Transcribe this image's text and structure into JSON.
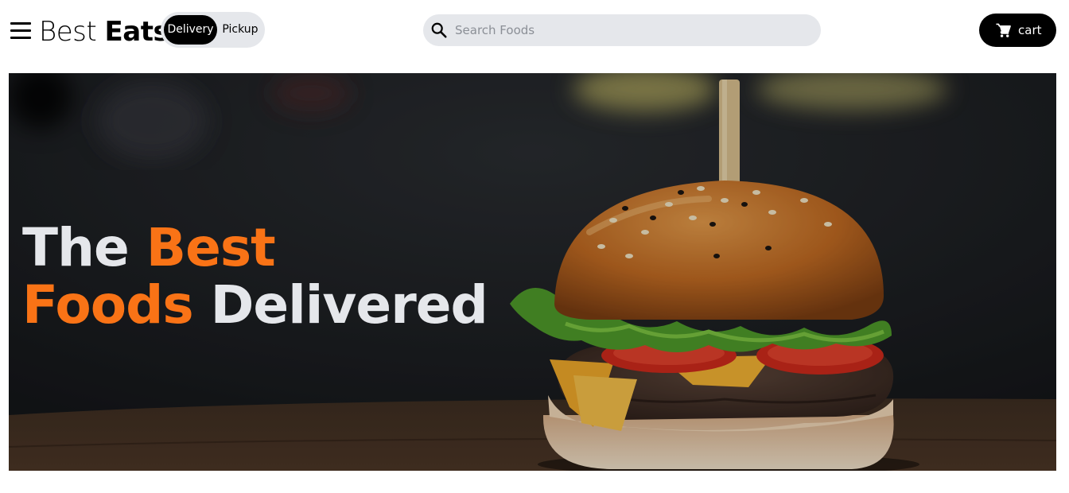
{
  "header": {
    "brand_light": "Best",
    "brand_bold": "Eats",
    "delivery_label": "Delivery",
    "pickup_label": "Pickup",
    "search_placeholder": "Search Foods",
    "cart_label": "cart"
  },
  "hero": {
    "line1_white": "The",
    "line1_orange": "Best",
    "line2_orange": "Foods",
    "line2_white": "Delivered"
  },
  "icons": {
    "menu": "hamburger-menu-icon",
    "search": "search-icon",
    "cart": "cart-icon"
  },
  "colors": {
    "accent": "#f97316",
    "hero_text": "#e5e7eb",
    "pill_bg": "#e5e7eb",
    "active_pill": "#000000"
  }
}
